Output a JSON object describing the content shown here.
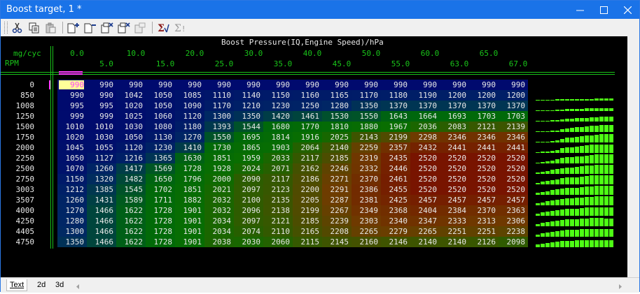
{
  "window": {
    "title": "Boost target, 1 *"
  },
  "toolbar": {
    "buttons": [
      "cut-icon",
      "copy-icon",
      "paste-icon",
      "insert-column-icon",
      "delete-column-icon",
      "insert-row-icon",
      "delete-row-icon",
      "copy-row-icon",
      "sum-icon",
      "sum-disabled-icon"
    ]
  },
  "map": {
    "title": "Boost Pressure(IQ,Engine Speed)/hPa",
    "x_unit": "mg/cyc",
    "y_unit": "RPM",
    "x_axis_upper": [
      "0.0",
      "10.0",
      "20.0",
      "30.0",
      "40.0",
      "50.0",
      "60.0",
      "65.0"
    ],
    "x_axis_lower": [
      "5.0",
      "15.0",
      "25.0",
      "35.0",
      "45.0",
      "55.0",
      "63.0",
      "67.0"
    ],
    "rpm": [
      "0",
      "850",
      "1008",
      "1250",
      "1500",
      "1750",
      "2000",
      "2250",
      "2500",
      "2750",
      "3003",
      "3507",
      "4000",
      "4250",
      "4405",
      "4750"
    ],
    "selected_cell": {
      "row": 0,
      "col": 0
    },
    "values": [
      [
        990,
        990,
        990,
        990,
        990,
        990,
        990,
        990,
        990,
        990,
        990,
        990,
        990,
        990,
        990,
        990
      ],
      [
        990,
        990,
        1042,
        1050,
        1085,
        1110,
        1140,
        1150,
        1160,
        1165,
        1170,
        1180,
        1190,
        1200,
        1200,
        1200
      ],
      [
        995,
        995,
        1020,
        1050,
        1090,
        1170,
        1210,
        1230,
        1250,
        1280,
        1350,
        1370,
        1370,
        1370,
        1370,
        1370
      ],
      [
        999,
        999,
        1025,
        1060,
        1120,
        1300,
        1350,
        1420,
        1461,
        1530,
        1550,
        1643,
        1664,
        1693,
        1703,
        1703
      ],
      [
        1010,
        1010,
        1030,
        1080,
        1180,
        1393,
        1544,
        1680,
        1770,
        1810,
        1880,
        1967,
        2036,
        2083,
        2121,
        2139
      ],
      [
        1020,
        1030,
        1050,
        1130,
        1270,
        1550,
        1695,
        1814,
        1916,
        2025,
        2143,
        2199,
        2298,
        2346,
        2346,
        2346
      ],
      [
        1045,
        1055,
        1120,
        1230,
        1410,
        1730,
        1865,
        1903,
        2064,
        2140,
        2259,
        2357,
        2432,
        2441,
        2441,
        2441
      ],
      [
        1050,
        1127,
        1216,
        1365,
        1630,
        1851,
        1959,
        2033,
        2117,
        2185,
        2319,
        2435,
        2520,
        2520,
        2520,
        2520
      ],
      [
        1070,
        1260,
        1417,
        1569,
        1728,
        1928,
        2024,
        2071,
        2162,
        2246,
        2332,
        2446,
        2520,
        2520,
        2520,
        2520
      ],
      [
        1150,
        1320,
        1482,
        1650,
        1796,
        2000,
        2090,
        2117,
        2186,
        2271,
        2370,
        2461,
        2520,
        2520,
        2520,
        2520
      ],
      [
        1212,
        1385,
        1545,
        1702,
        1851,
        2021,
        2097,
        2123,
        2200,
        2291,
        2386,
        2455,
        2520,
        2520,
        2520,
        2520
      ],
      [
        1260,
        1431,
        1589,
        1711,
        1882,
        2032,
        2100,
        2135,
        2205,
        2287,
        2381,
        2425,
        2457,
        2457,
        2457,
        2457
      ],
      [
        1270,
        1466,
        1622,
        1728,
        1901,
        2032,
        2096,
        2138,
        2199,
        2267,
        2349,
        2368,
        2404,
        2384,
        2370,
        2363
      ],
      [
        1280,
        1466,
        1622,
        1728,
        1901,
        2034,
        2097,
        2121,
        2185,
        2239,
        2303,
        2340,
        2347,
        2333,
        2313,
        2306
      ],
      [
        1300,
        1466,
        1622,
        1728,
        1901,
        2034,
        2074,
        2110,
        2165,
        2208,
        2265,
        2279,
        2265,
        2251,
        2251,
        2238
      ],
      [
        1350,
        1466,
        1622,
        1728,
        1901,
        2038,
        2030,
        2060,
        2115,
        2145,
        2160,
        2146,
        2140,
        2140,
        2126,
        2098
      ]
    ],
    "min_value": 990,
    "max_value": 2520
  },
  "tabs": [
    "Text",
    "2d",
    "3d"
  ],
  "colors": {
    "grid_line": "#19c419",
    "text": "#e8e8e8",
    "selected_text": "#ff40ff",
    "selected_bg": "#ffff99",
    "bar": "#4dff14"
  }
}
